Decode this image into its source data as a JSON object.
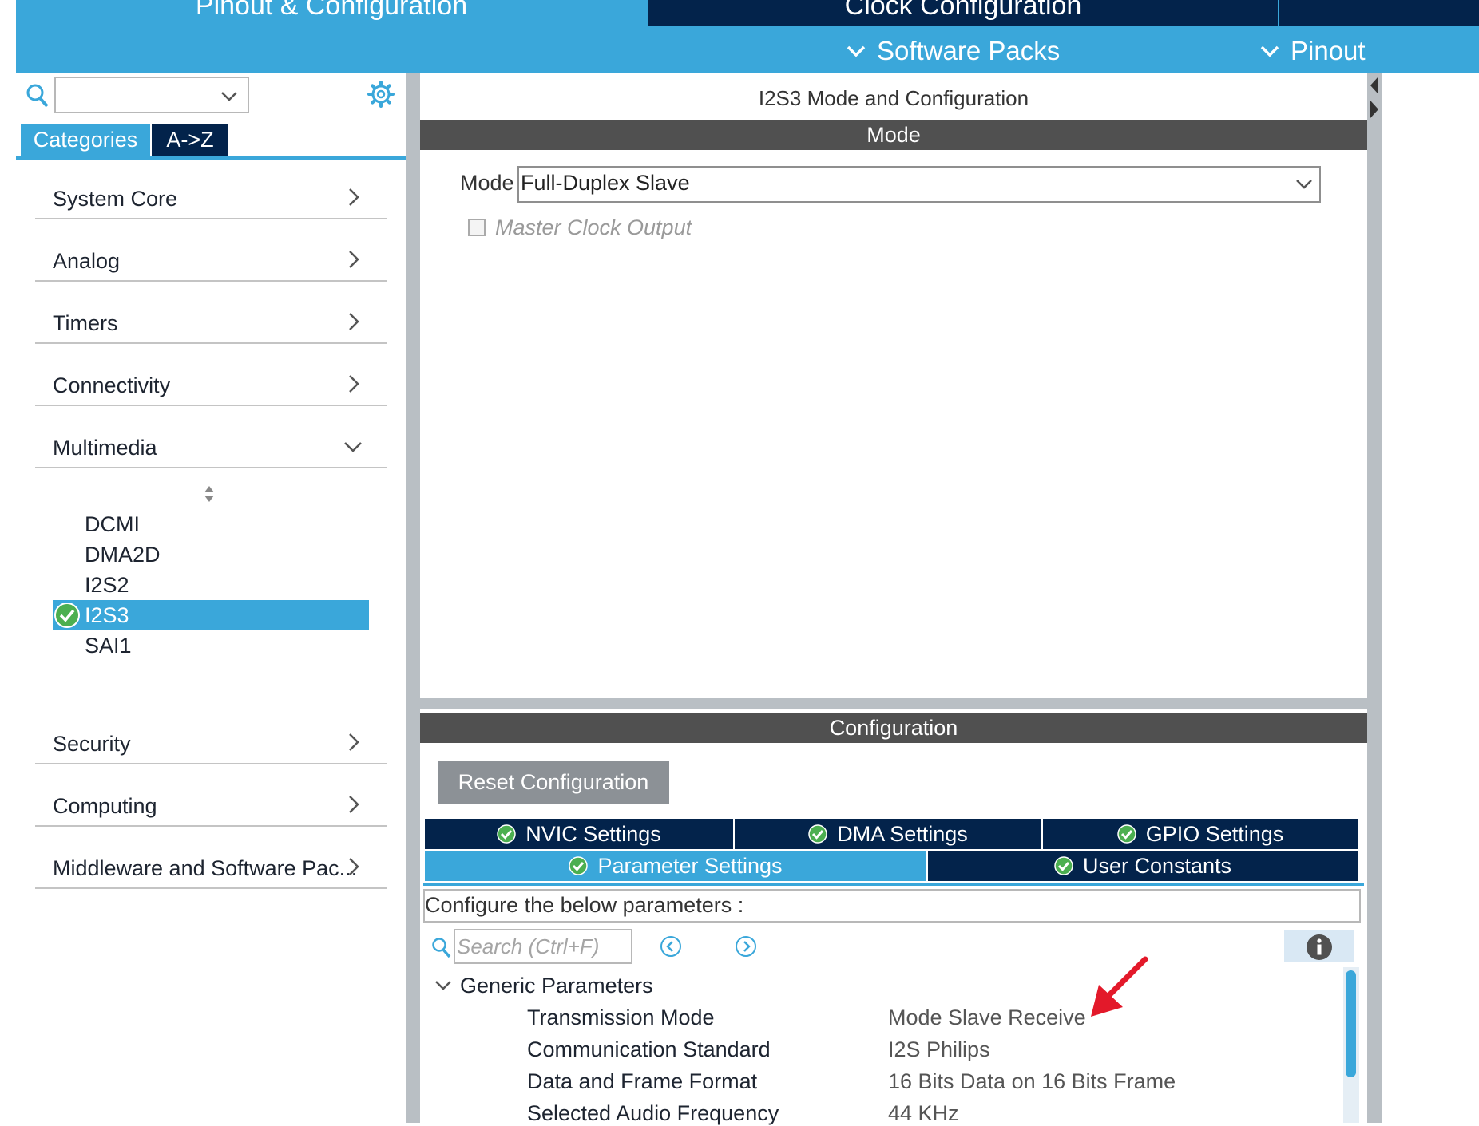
{
  "header": {
    "tabs": [
      {
        "label": "Pinout & Configuration",
        "active": true
      },
      {
        "label": "Clock Configuration",
        "active": false
      }
    ],
    "subtabs": [
      {
        "label": "Software Packs"
      },
      {
        "label": "Pinout"
      }
    ]
  },
  "left_panel": {
    "search": {
      "value": ""
    },
    "view_tabs": [
      {
        "label": "Categories",
        "active": true
      },
      {
        "label": "A->Z",
        "active": false
      }
    ],
    "categories_top": [
      {
        "label": "System Core"
      },
      {
        "label": "Analog"
      },
      {
        "label": "Timers"
      },
      {
        "label": "Connectivity"
      },
      {
        "label": "Multimedia",
        "expanded": true
      }
    ],
    "multimedia_items": [
      {
        "label": "DCMI"
      },
      {
        "label": "DMA2D"
      },
      {
        "label": "I2S2"
      },
      {
        "label": "I2S3",
        "selected": true,
        "enabled": true
      },
      {
        "label": "SAI1"
      }
    ],
    "categories_bottom": [
      {
        "label": "Security"
      },
      {
        "label": "Computing"
      },
      {
        "label": "Middleware and Software Pac..."
      }
    ]
  },
  "mode_panel": {
    "title": "I2S3 Mode and Configuration",
    "section": "Mode",
    "mode_label": "Mode",
    "mode_value": "Full-Duplex Slave",
    "master_clock_output": {
      "label": "Master Clock Output",
      "checked": false,
      "enabled": false
    }
  },
  "config_panel": {
    "section": "Configuration",
    "reset_label": "Reset Configuration",
    "tabs_row1": [
      {
        "label": "NVIC Settings"
      },
      {
        "label": "DMA Settings"
      },
      {
        "label": "GPIO Settings"
      }
    ],
    "tabs_row2": [
      {
        "label": "Parameter Settings",
        "active": true
      },
      {
        "label": "User Constants"
      }
    ],
    "hint": "Configure the below parameters :",
    "search_placeholder": "Search (Ctrl+F)",
    "group": "Generic Parameters",
    "params": [
      {
        "name": "Transmission Mode",
        "value": "Mode Slave Receive"
      },
      {
        "name": "Communication Standard",
        "value": "I2S Philips"
      },
      {
        "name": "Data and Frame Format",
        "value": "16 Bits Data on 16 Bits Frame"
      },
      {
        "name": "Selected Audio Frequency",
        "value": "44 KHz"
      }
    ]
  },
  "colors": {
    "accent": "#3aa7da",
    "navy": "#03234b",
    "section_header": "#505050",
    "check_green": "#4caf50",
    "annotation_red": "#e3192a"
  }
}
